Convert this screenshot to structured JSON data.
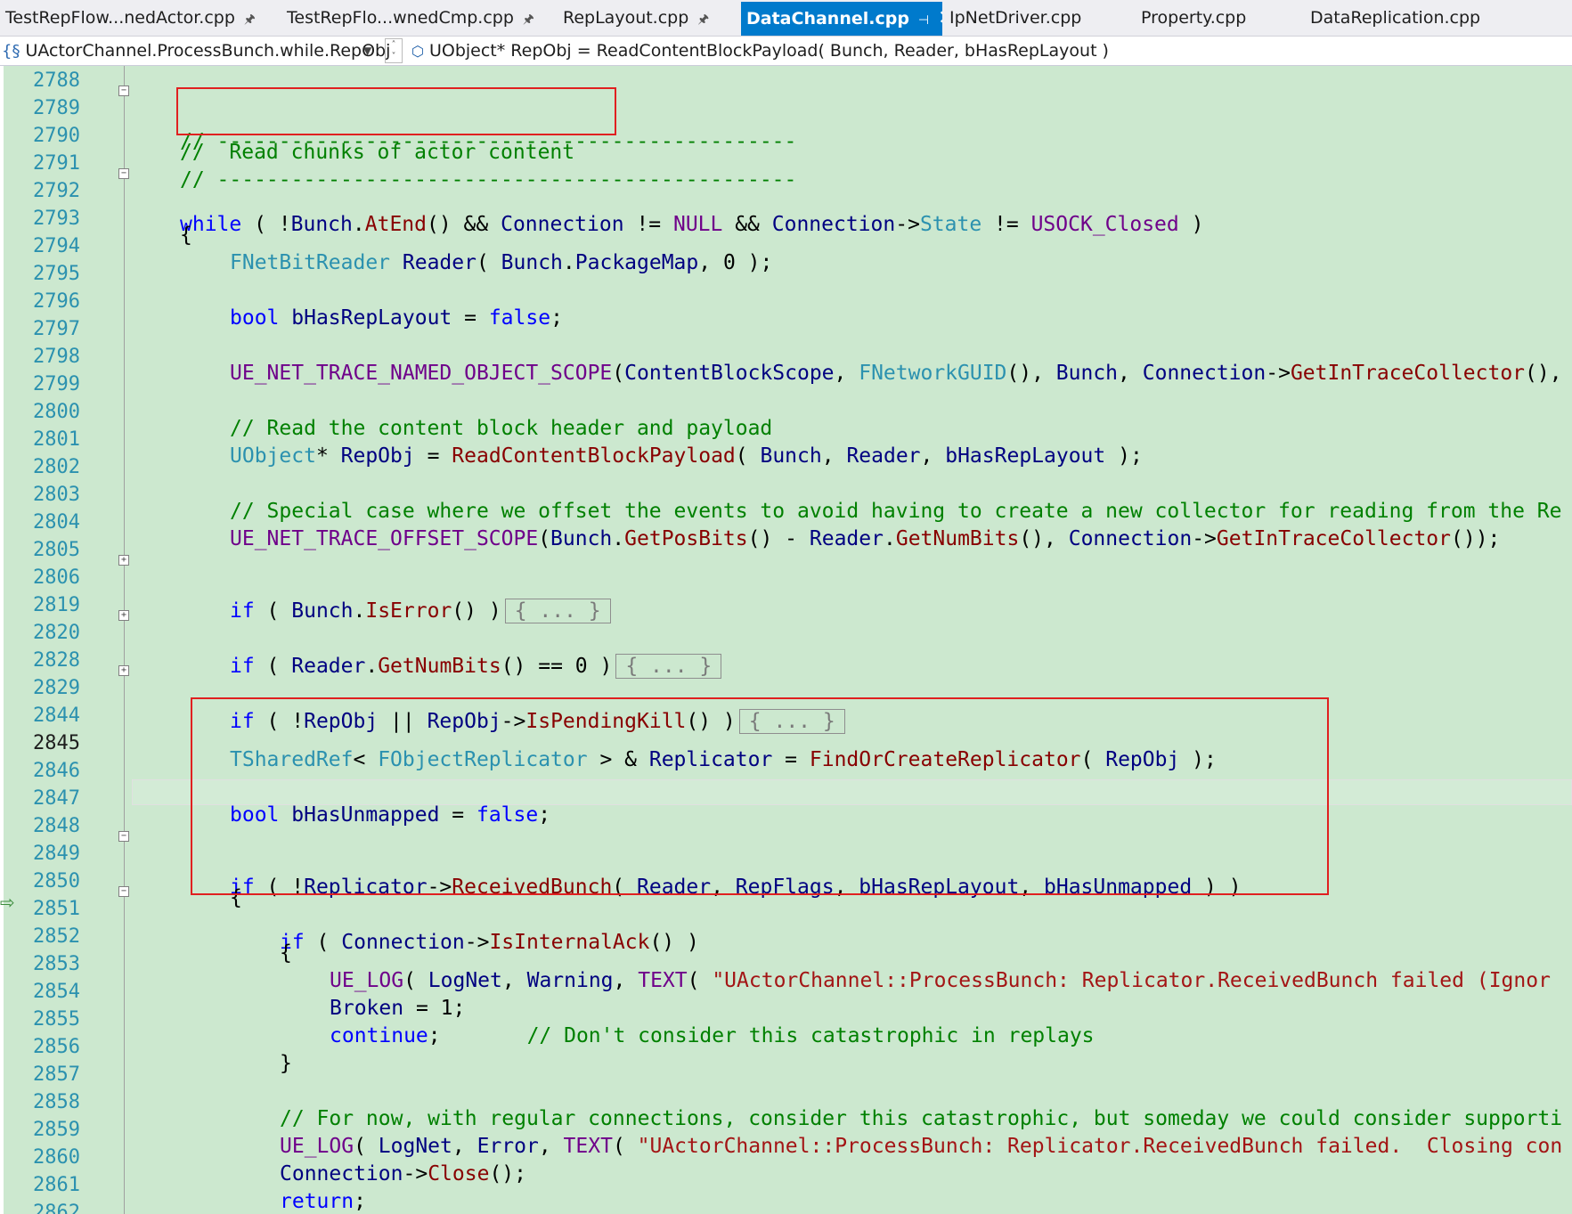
{
  "tabs": [
    {
      "label": "TestRepFlow...nedActor.cpp",
      "pinned": true,
      "active": false
    },
    {
      "label": "TestRepFlo...wnedCmp.cpp",
      "pinned": true,
      "active": false
    },
    {
      "label": "RepLayout.cpp",
      "pinned": true,
      "active": false
    },
    {
      "label": "DataChannel.cpp",
      "pinned": true,
      "active": true
    },
    {
      "label": "IpNetDriver.cpp",
      "pinned": false,
      "active": false
    },
    {
      "label": "Property.cpp",
      "pinned": false,
      "active": false
    },
    {
      "label": "DataReplication.cpp",
      "pinned": false,
      "active": false
    }
  ],
  "icons": {
    "pin": "pin-icon",
    "close": "close-icon",
    "scope": "scope-icon",
    "member": "member-icon"
  },
  "navbar": {
    "scope": "UActorChannel.ProcessBunch.while.RepObj",
    "member": "UObject* RepObj = ReadContentBlockPayload( Bunch, Reader, bHasRepLayout )"
  },
  "editor": {
    "current_line": "2845",
    "execution_marker_line": "2849",
    "collapsed_block_text": "{ ... }",
    "lines": [
      {
        "n": "2788",
        "code": ""
      },
      {
        "n": "2789",
        "code": "// -----------------------------------------------"
      },
      {
        "n": "2790",
        "code": "//  Read chunks of actor content"
      },
      {
        "n": "2791",
        "code": "// -----------------------------------------------"
      },
      {
        "n": "2792",
        "code": "while ( !Bunch.AtEnd() && Connection != NULL && Connection->State != USOCK_Closed )"
      },
      {
        "n": "2793",
        "code": "{"
      },
      {
        "n": "2794",
        "code": "FNetBitReader Reader( Bunch.PackageMap, 0 );"
      },
      {
        "n": "2795",
        "code": ""
      },
      {
        "n": "2796",
        "code": "bool bHasRepLayout = false;"
      },
      {
        "n": "2797",
        "code": ""
      },
      {
        "n": "2798",
        "code": "UE_NET_TRACE_NAMED_OBJECT_SCOPE(ContentBlockScope, FNetworkGUID(), Bunch, Connection->GetInTraceCollector(),"
      },
      {
        "n": "2799",
        "code": ""
      },
      {
        "n": "2800",
        "code": "// Read the content block header and payload"
      },
      {
        "n": "2801",
        "code": "UObject* RepObj = ReadContentBlockPayload( Bunch, Reader, bHasRepLayout );"
      },
      {
        "n": "2802",
        "code": ""
      },
      {
        "n": "2803",
        "code": "// Special case where we offset the events to avoid having to create a new collector for reading from the Re"
      },
      {
        "n": "2804",
        "code": "UE_NET_TRACE_OFFSET_SCOPE(Bunch.GetPosBits() - Reader.GetNumBits(), Connection->GetInTraceCollector());"
      },
      {
        "n": "2805",
        "code": ""
      },
      {
        "n": "2806",
        "code": "if ( Bunch.IsError() )"
      },
      {
        "n": "2819",
        "code": ""
      },
      {
        "n": "2820",
        "code": "if ( Reader.GetNumBits() == 0 )"
      },
      {
        "n": "2828",
        "code": ""
      },
      {
        "n": "2829",
        "code": "if ( !RepObj || RepObj->IsPendingKill() )"
      },
      {
        "n": "2844",
        "code": ""
      },
      {
        "n": "2845",
        "code": "TSharedRef< FObjectReplicator > & Replicator = FindOrCreateReplicator( RepObj );"
      },
      {
        "n": "2846",
        "code": ""
      },
      {
        "n": "2847",
        "code": "bool bHasUnmapped = false;"
      },
      {
        "n": "2848",
        "code": ""
      },
      {
        "n": "2849",
        "code": "if ( !Replicator->ReceivedBunch( Reader, RepFlags, bHasRepLayout, bHasUnmapped ) )"
      },
      {
        "n": "2850",
        "code": "{"
      },
      {
        "n": "2851",
        "code": "if ( Connection->IsInternalAck() )"
      },
      {
        "n": "2852",
        "code": "{"
      },
      {
        "n": "2853",
        "code": "UE_LOG( LogNet, Warning, TEXT( \"UActorChannel::ProcessBunch: Replicator.ReceivedBunch failed (Ignor"
      },
      {
        "n": "2854",
        "code": "Broken = 1;"
      },
      {
        "n": "2855",
        "code": "continue;       // Don't consider this catastrophic in replays"
      },
      {
        "n": "2856",
        "code": "}"
      },
      {
        "n": "2857",
        "code": ""
      },
      {
        "n": "2858",
        "code": "// For now, with regular connections, consider this catastrophic, but someday we could consider supporti"
      },
      {
        "n": "2859",
        "code": "UE_LOG( LogNet, Error, TEXT( \"UActorChannel::ProcessBunch: Replicator.ReceivedBunch failed.  Closing con"
      },
      {
        "n": "2860",
        "code": "Connection->Close();"
      },
      {
        "n": "2861",
        "code": "return;"
      },
      {
        "n": "2862",
        "code": "}"
      }
    ]
  },
  "colors": {
    "editor_background": "#CCE8CF",
    "active_tab": "#007ACC",
    "keyword": "#0000FF",
    "comment": "#008000",
    "type": "#2B91AF",
    "function": "#880000",
    "identifier": "#000080",
    "macro": "#6F008A",
    "string": "#A31515",
    "annotation_box": "#E02020"
  }
}
